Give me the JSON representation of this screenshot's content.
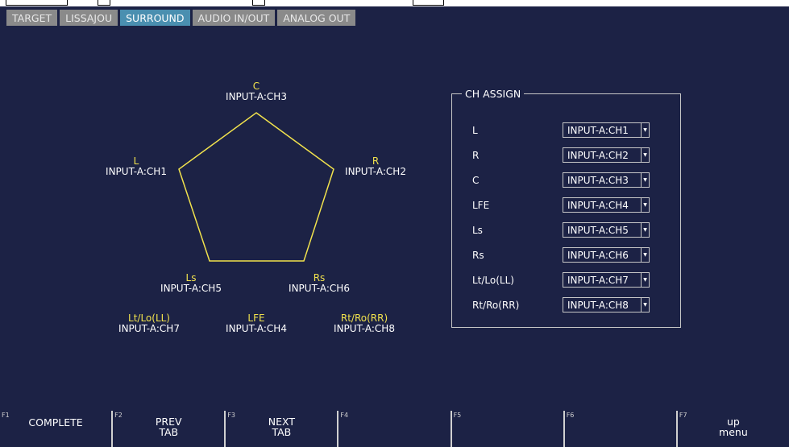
{
  "tabs": [
    {
      "label": "TARGET",
      "active": false
    },
    {
      "label": "LISSAJOU",
      "active": false
    },
    {
      "label": "SURROUND",
      "active": true
    },
    {
      "label": "AUDIO IN/OUT",
      "active": false
    },
    {
      "label": "ANALOG OUT",
      "active": false
    }
  ],
  "diagram": {
    "pentagon_color": "#f1e24d",
    "label_color": "#f1e24d",
    "speakers": {
      "c": {
        "name": "C",
        "source": "INPUT-A:CH3"
      },
      "l": {
        "name": "L",
        "source": "INPUT-A:CH1"
      },
      "r": {
        "name": "R",
        "source": "INPUT-A:CH2"
      },
      "ls": {
        "name": "Ls",
        "source": "INPUT-A:CH5"
      },
      "rs": {
        "name": "Rs",
        "source": "INPUT-A:CH6"
      },
      "lt": {
        "name": "Lt/Lo(LL)",
        "source": "INPUT-A:CH7"
      },
      "lfe": {
        "name": "LFE",
        "source": "INPUT-A:CH4"
      },
      "rt": {
        "name": "Rt/Ro(RR)",
        "source": "INPUT-A:CH8"
      }
    }
  },
  "ch_assign": {
    "title": "CH ASSIGN",
    "rows": [
      {
        "label": "L",
        "value": "INPUT-A:CH1"
      },
      {
        "label": "R",
        "value": "INPUT-A:CH2"
      },
      {
        "label": "C",
        "value": "INPUT-A:CH3"
      },
      {
        "label": "LFE",
        "value": "INPUT-A:CH4"
      },
      {
        "label": "Ls",
        "value": "INPUT-A:CH5"
      },
      {
        "label": "Rs",
        "value": "INPUT-A:CH6"
      },
      {
        "label": "Lt/Lo(LL)",
        "value": "INPUT-A:CH7"
      },
      {
        "label": "Rt/Ro(RR)",
        "value": "INPUT-A:CH8"
      }
    ]
  },
  "fkeys": [
    {
      "num": "F1",
      "label": "COMPLETE"
    },
    {
      "num": "F2",
      "label": "PREV\nTAB"
    },
    {
      "num": "F3",
      "label": "NEXT\nTAB"
    },
    {
      "num": "F4",
      "label": ""
    },
    {
      "num": "F5",
      "label": ""
    },
    {
      "num": "F6",
      "label": ""
    },
    {
      "num": "F7",
      "label": "up\nmenu"
    }
  ],
  "colors": {
    "background": "#1c2245",
    "tab_active": "#4a8fb0",
    "tab_inactive": "#8a8a8a",
    "accent_yellow": "#f1e24d"
  }
}
